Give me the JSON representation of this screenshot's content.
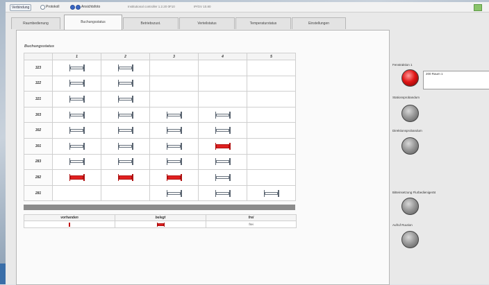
{
  "topbar": {
    "button_label": "Verbindung",
    "radio_protocol_label": "Protokoll",
    "radio_overview_label": "Ansichtsfoto",
    "info_version": "Institutional controller 1.2.20 0F10",
    "info_ip": "IP/GV 10.80"
  },
  "tabs": [
    {
      "label": "Raumbedienung"
    },
    {
      "label": "Buchungsstatus"
    },
    {
      "label": "Betriebszust."
    },
    {
      "label": "Verteilstatus"
    },
    {
      "label": "Temperaturstatus"
    },
    {
      "label": "Einstellungen"
    }
  ],
  "active_tab": 1,
  "booking": {
    "title": "Buchungsstatus",
    "columns": [
      "1",
      "2",
      "3",
      "4",
      "5"
    ],
    "rows": [
      {
        "label": "323",
        "beds": [
          "free",
          "free",
          "",
          "",
          ""
        ]
      },
      {
        "label": "322",
        "beds": [
          "free",
          "free",
          "",
          "",
          ""
        ]
      },
      {
        "label": "321",
        "beds": [
          "free",
          "free",
          "",
          "",
          ""
        ]
      },
      {
        "label": "303",
        "beds": [
          "free",
          "free",
          "free",
          "free",
          ""
        ]
      },
      {
        "label": "302",
        "beds": [
          "free",
          "free",
          "free",
          "free",
          ""
        ]
      },
      {
        "label": "301",
        "beds": [
          "free",
          "free",
          "free",
          "occupied",
          ""
        ]
      },
      {
        "label": "283",
        "beds": [
          "free",
          "free",
          "free",
          "free",
          ""
        ]
      },
      {
        "label": "282",
        "beds": [
          "occupied",
          "occupied",
          "occupied",
          "free",
          ""
        ]
      },
      {
        "label": "281",
        "beds": [
          "",
          "",
          "free",
          "free",
          "free"
        ]
      }
    ],
    "legend": {
      "headers": [
        "vorhanden",
        "belegt",
        "frei"
      ],
      "free_text": "frei"
    }
  },
  "side": {
    "l1_label": "Fenstraktion 1",
    "l1_box_text": "200 Raum 1",
    "l2_label": "Stationsprobandum",
    "l3_label": "Direktionsprobandum",
    "l4_label": "Bitteinsetzung Flurbedienigerät",
    "l5_label": "Aufruf Ruution"
  },
  "colors": {
    "occupied": "#e02020",
    "lamp_active": "#e01616",
    "lamp_idle": "#9a9a9a",
    "radio_selected": "#3a66c4"
  }
}
